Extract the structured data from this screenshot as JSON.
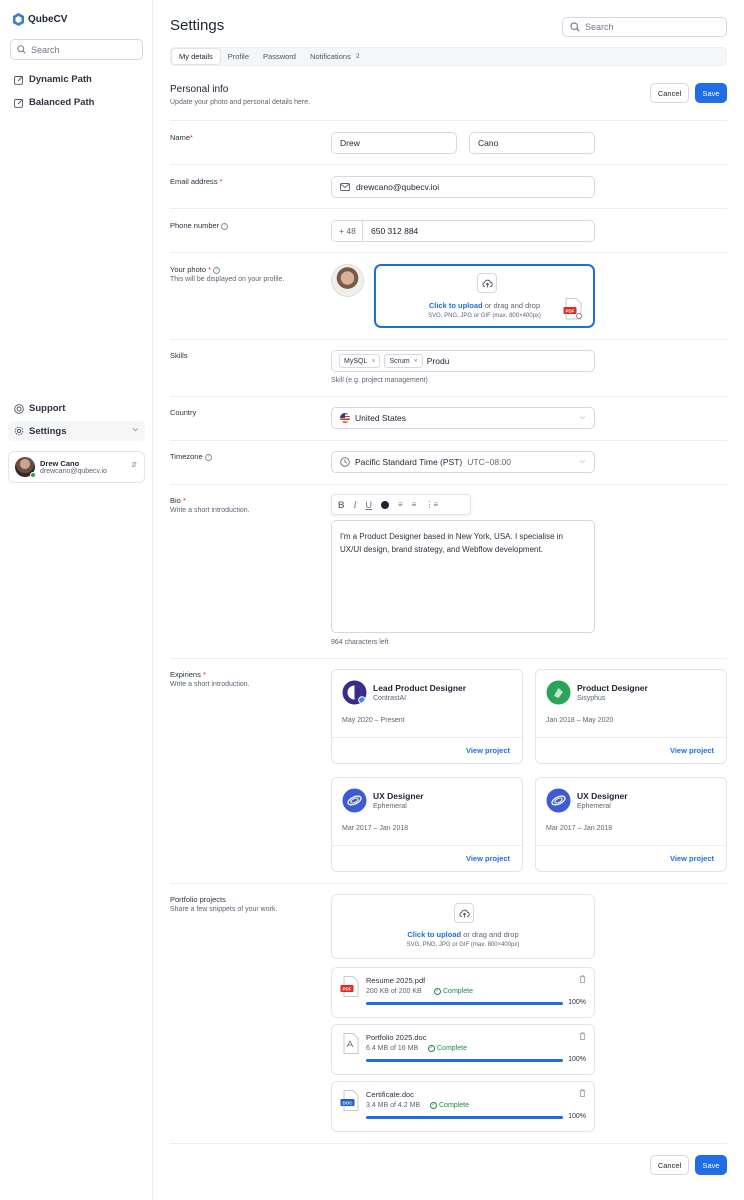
{
  "sidebar": {
    "logo": "QubeCV",
    "search_placeholder": "Search",
    "nav": [
      {
        "label": "Dynamic Path"
      },
      {
        "label": "Balanced Path"
      }
    ],
    "support": "Support",
    "settings": "Settings",
    "user": {
      "name": "Drew Cano",
      "email": "drewcano@qubecv.io"
    }
  },
  "header": {
    "title": "Settings",
    "search_placeholder": "Search"
  },
  "tabs": [
    {
      "label": "My details"
    },
    {
      "label": "Profile"
    },
    {
      "label": "Password"
    },
    {
      "label": "Notifications",
      "count": "2"
    }
  ],
  "personal": {
    "title": "Personal info",
    "subtitle": "Update your photo and personal details here.",
    "cancel": "Cancel",
    "save": "Save"
  },
  "form": {
    "name_label": "Name",
    "first_name": "Drew",
    "last_name": "Cano",
    "email_label": "Email address",
    "email": "drewcano@qubecv.ioi",
    "phone_label": "Phone number",
    "phone_code": "+ 48",
    "phone": "650 312 884",
    "photo_label": "Your photo",
    "photo_sub": "This will be displayed on your profile.",
    "upload_link": "Click to upload",
    "upload_text": "or drag and drop",
    "upload_formats": "SVG, PNG, JPG or GIF (max. 800×400px)",
    "skills_label": "Skills",
    "skills": [
      "MySQL",
      "Scrum"
    ],
    "skills_input": "Produ",
    "skills_hint": "Skill (e.g. project management)",
    "country_label": "Country",
    "country": "United States",
    "timezone_label": "Timezone",
    "timezone": "Pacific Standard Time (PST)",
    "timezone_offset": "UTC−08:00",
    "bio_label": "Bio",
    "bio_sub": "Write a short introduction.",
    "bio_text": "I'm a Product Designer based in New York, USA. I specialise in UX/UI design, brand strategy, and Webflow development.",
    "bio_remaining": "964 characters left",
    "exp_label": "Expiriens",
    "exp_sub": "Write a short introduction."
  },
  "experiences": [
    {
      "title": "Lead Product Designer",
      "company": "ContrastAI",
      "dates": "May 2020 – Present",
      "link": "View project",
      "color": "#3b2a8c"
    },
    {
      "title": "Product Designer",
      "company": "Sisyphus",
      "dates": "Jan 2018 – May 2020",
      "link": "View project",
      "color": "#2aa45b"
    },
    {
      "title": "UX Designer",
      "company": "Ephemeral",
      "dates": "Mar 2017 – Jan 2018",
      "link": "View project",
      "color": "#3d5bd9"
    },
    {
      "title": "UX Designer",
      "company": "Ephemeral",
      "dates": "Mar 2017 – Jan 2018",
      "link": "View project",
      "color": "#3d5bd9"
    }
  ],
  "portfolio": {
    "label": "Portfolio projects",
    "sub": "Share a few snippets of your work.",
    "upload_link": "Click to upload",
    "upload_text": "or drag and drop",
    "upload_formats": "SVG, PNG, JPG or GIF (max. 800×400px)",
    "files": [
      {
        "name": "Resume 2025.pdf",
        "size": "200 KB of 200 KB",
        "status": "Complete",
        "percent": "100%",
        "progress": 1.0,
        "type": "PDF"
      },
      {
        "name": "Portfolio 2025.doc",
        "size": "6.4 MB of 16 MB",
        "status": "Complete",
        "percent": "100%",
        "progress": 1.0,
        "type": "doc"
      },
      {
        "name": "Certificate.doc",
        "size": "3.4 MB of 4.2 MB",
        "status": "Complete",
        "percent": "100%",
        "progress": 1.0,
        "type": "DOC"
      }
    ]
  },
  "footer": {
    "cancel": "Cancel",
    "save": "Save"
  },
  "colors": {
    "accent": "#1f6ee5",
    "success": "#1d8a4e",
    "required": "#d92d20"
  }
}
